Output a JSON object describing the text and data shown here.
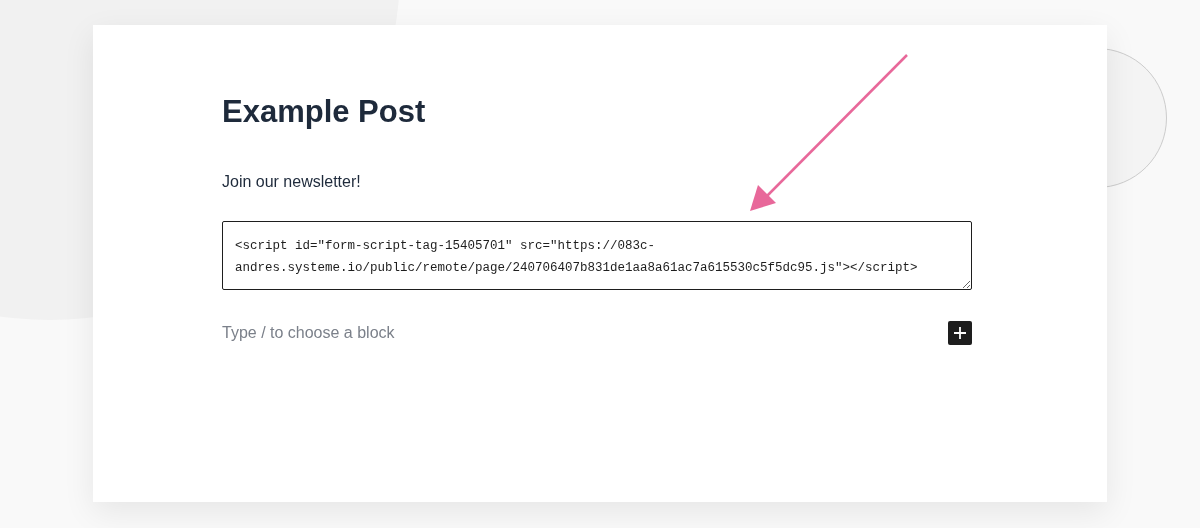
{
  "post": {
    "title": "Example Post",
    "paragraph": "Join our newsletter!",
    "html_block": {
      "value": "<script id=\"form-script-tag-15405701\" src=\"https://083c-andres.systeme.io/public/remote/page/240706407b831de1aa8a61ac7a615530c5f5dc95.js\"></script>"
    },
    "block_prompt": {
      "placeholder": "Type / to choose a block"
    }
  }
}
